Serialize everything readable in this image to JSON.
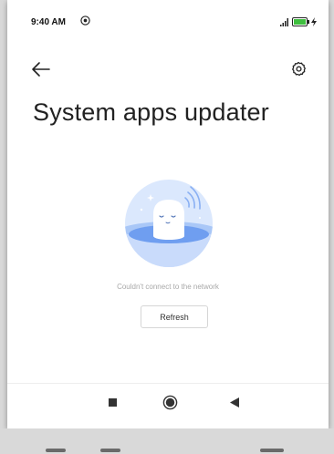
{
  "status_bar": {
    "time": "9:40 AM",
    "icons": [
      "do-not-disturb-icon",
      "signal-icon",
      "battery-icon",
      "charging-icon"
    ]
  },
  "toolbar": {
    "back_icon": "arrow-left-icon",
    "settings_icon": "gear-icon"
  },
  "page": {
    "title": "System apps updater"
  },
  "empty_state": {
    "illustration": "sleeping-ghost-no-network-illustration",
    "message": "Couldn't connect to the network",
    "refresh_label": "Refresh"
  },
  "nav_bar": {
    "items": [
      "recent-apps-icon",
      "home-icon",
      "back-icon"
    ]
  },
  "colors": {
    "illustration_blue": "#c8dcfb",
    "illustration_dark_blue": "#6f9ef0",
    "text_muted": "#a8a8a8"
  }
}
